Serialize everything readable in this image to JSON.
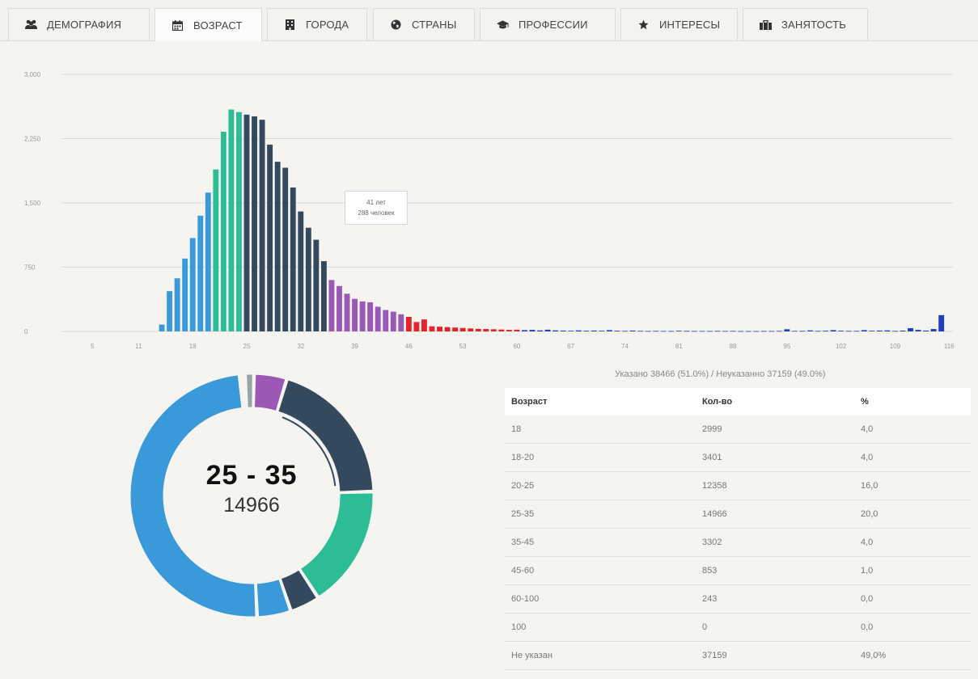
{
  "tabs": [
    {
      "label": "ДЕМОГРАФИЯ",
      "icon": "users-icon",
      "active": false
    },
    {
      "label": "ВОЗРАСТ",
      "icon": "calendar-icon",
      "active": true
    },
    {
      "label": "ГОРОДА",
      "icon": "building-icon",
      "active": false
    },
    {
      "label": "СТРАНЫ",
      "icon": "globe-icon",
      "active": false
    },
    {
      "label": "ПРОФЕССИИ",
      "icon": "graduation-cap-icon",
      "active": false
    },
    {
      "label": "ИНТЕРЕСЫ",
      "icon": "star-icon",
      "active": false
    },
    {
      "label": "ЗАНЯТОСТЬ",
      "icon": "briefcase-icon",
      "active": false
    }
  ],
  "tooltip": {
    "line1": "41 лет",
    "line2": "288 человек"
  },
  "donut": {
    "range": "25 - 35",
    "count": "14966"
  },
  "summary": "Указано 38466 (51.0%) / Неуказанно 37159 (49.0%)",
  "table": {
    "headers": [
      "Возраст",
      "Кол-во",
      "%"
    ],
    "rows": [
      [
        "18",
        "2999",
        "4,0"
      ],
      [
        "18-20",
        "3401",
        "4,0"
      ],
      [
        "20-25",
        "12358",
        "16,0"
      ],
      [
        "25-35",
        "14966",
        "20,0"
      ],
      [
        "35-45",
        "3302",
        "4,0"
      ],
      [
        "45-60",
        "853",
        "1,0"
      ],
      [
        "60-100",
        "243",
        "0,0"
      ],
      [
        "100",
        "0",
        "0,0"
      ],
      [
        "Не указан",
        "37159",
        "49,0%"
      ]
    ]
  },
  "chart_data": [
    {
      "type": "bar",
      "ylim": [
        0,
        3000
      ],
      "yticks": [
        "0",
        "750",
        "1,500",
        "2,250",
        "3,000"
      ],
      "xticks": [
        "5",
        "11",
        "18",
        "25",
        "32",
        "39",
        "46",
        "53",
        "60",
        "67",
        "74",
        "81",
        "88",
        "95",
        "102",
        "109",
        "116"
      ],
      "x": [
        14,
        15,
        16,
        17,
        18,
        19,
        20,
        21,
        22,
        23,
        24,
        25,
        26,
        27,
        28,
        29,
        30,
        31,
        32,
        33,
        34,
        35,
        36,
        37,
        38,
        39,
        40,
        41,
        42,
        43,
        44,
        45,
        46,
        47,
        48,
        49,
        50,
        51,
        52,
        53,
        54,
        55,
        56,
        57,
        58,
        59,
        60,
        61,
        62,
        63,
        64,
        65,
        66,
        67,
        68,
        69,
        70,
        71,
        72,
        73,
        74,
        75,
        76,
        77,
        78,
        79,
        80,
        81,
        82,
        83,
        84,
        85,
        86,
        87,
        88,
        89,
        90,
        91,
        92,
        93,
        94,
        95,
        96,
        97,
        98,
        99,
        100,
        101,
        102,
        103,
        104,
        105,
        106,
        107,
        108,
        109,
        110,
        111,
        112,
        113,
        114,
        115,
        116
      ],
      "values": [
        80,
        470,
        620,
        850,
        1090,
        1350,
        1620,
        1890,
        2330,
        2590,
        2560,
        2530,
        2510,
        2470,
        2180,
        1980,
        1910,
        1680,
        1400,
        1210,
        1070,
        820,
        600,
        530,
        440,
        380,
        350,
        340,
        288,
        250,
        230,
        200,
        170,
        110,
        140,
        60,
        55,
        50,
        45,
        40,
        35,
        30,
        28,
        25,
        22,
        18,
        20,
        15,
        18,
        12,
        20,
        12,
        10,
        8,
        12,
        8,
        10,
        8,
        15,
        8,
        6,
        10,
        6,
        5,
        6,
        5,
        5,
        8,
        6,
        5,
        5,
        5,
        6,
        5,
        6,
        4,
        4,
        4,
        5,
        5,
        6,
        25,
        6,
        6,
        12,
        6,
        8,
        15,
        8,
        6,
        6,
        15,
        8,
        10,
        12,
        6,
        10,
        38,
        18,
        10,
        28,
        190
      ],
      "bar_colors": [
        {
          "from": 14,
          "to": 20,
          "color": "#3a9ad9"
        },
        {
          "from": 21,
          "to": 24,
          "color": "#2cbc96"
        },
        {
          "from": 25,
          "to": 35,
          "color": "#34495e"
        },
        {
          "from": 36,
          "to": 45,
          "color": "#9b59b6"
        },
        {
          "from": 46,
          "to": 60,
          "color": "#e3242b"
        },
        {
          "from": 61,
          "to": 116,
          "color": "#1f3fbf"
        }
      ],
      "highlight": {
        "x": 116,
        "color": "#1630c4"
      },
      "grid": true
    },
    {
      "type": "pie",
      "variant": "donut",
      "slices": [
        {
          "label": "Не указан",
          "value": 37159,
          "color": "#3a9ad9"
        },
        {
          "label": "18-20",
          "value": 3401,
          "color": "#3a9ad9"
        },
        {
          "label": "18",
          "value": 2999,
          "color": "#34495e"
        },
        {
          "label": "20-25",
          "value": 12358,
          "color": "#2cbc96"
        },
        {
          "label": "25-35",
          "value": 14966,
          "color": "#34495e"
        },
        {
          "label": "35-45",
          "value": 3302,
          "color": "#9b59b6"
        },
        {
          "label": "",
          "value": 900,
          "color": "#95a5a6"
        },
        {
          "label": "45-60",
          "value": 300,
          "color": "#e3242b"
        },
        {
          "label": "60-100",
          "value": 243,
          "color": "#2323b8"
        }
      ]
    }
  ]
}
